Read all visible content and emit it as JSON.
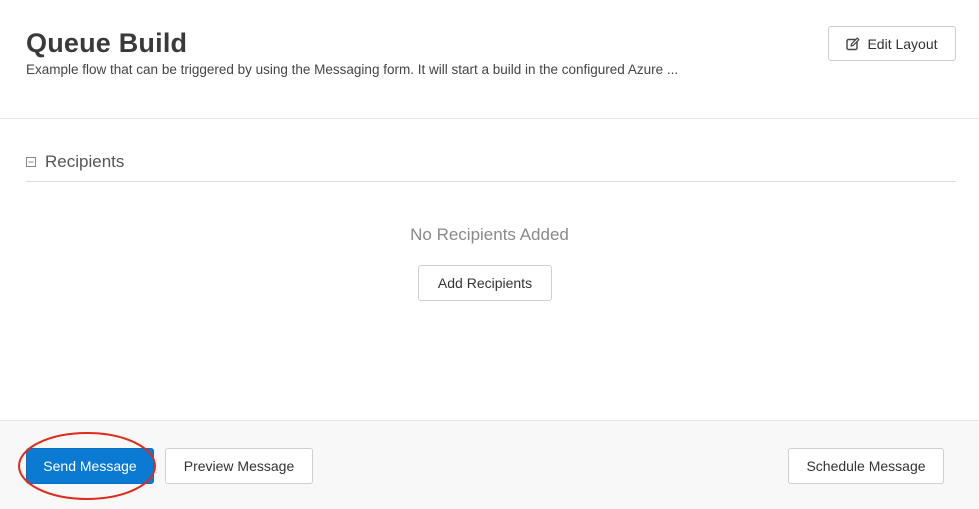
{
  "header": {
    "title": "Queue Build",
    "subtitle": "Example flow that can be triggered by using the Messaging form. It will start a build in the configured Azure ...",
    "edit_layout_label": "Edit Layout",
    "edit_icon": "edit-icon"
  },
  "recipients": {
    "section_title": "Recipients",
    "collapse_icon": "collapse-icon",
    "empty_text": "No Recipients Added",
    "add_label": "Add Recipients"
  },
  "footer": {
    "send_label": "Send Message",
    "preview_label": "Preview Message",
    "schedule_label": "Schedule Message"
  },
  "colors": {
    "primary_button": "#0a7ad3",
    "highlight": "#e02a1a"
  }
}
